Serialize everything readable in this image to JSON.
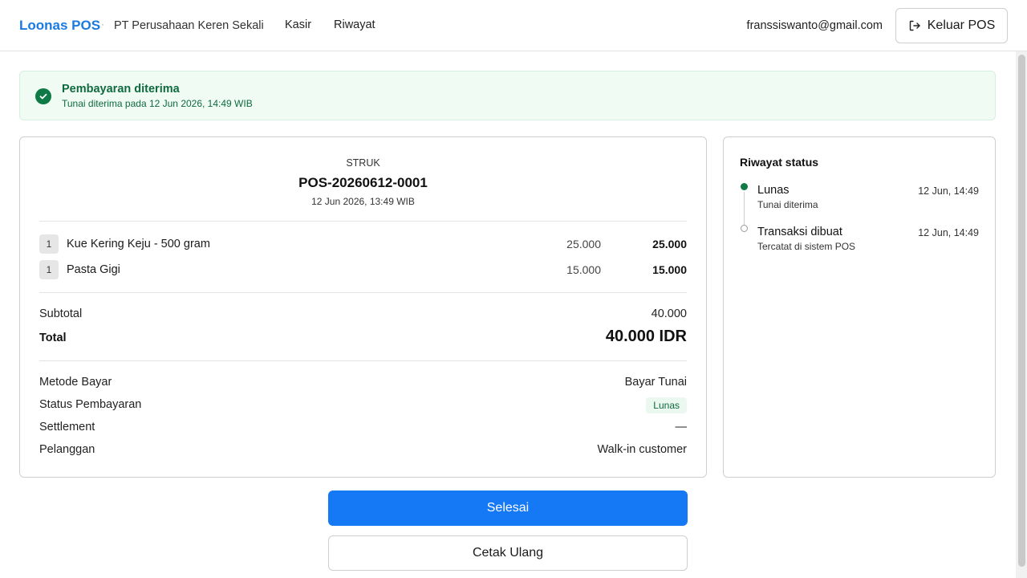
{
  "header": {
    "brand": "Loonas POS",
    "separator": "·",
    "company": "PT Perusahaan Keren Sekali",
    "nav": {
      "kasir": "Kasir",
      "riwayat": "Riwayat"
    },
    "email": "franssiswanto@gmail.com",
    "logout_label": "Keluar POS",
    "logout_icon": "logout-icon"
  },
  "alert": {
    "icon": "check-circle-icon",
    "title": "Pembayaran diterima",
    "subtitle": "Tunai diterima pada 12 Jun 2026, 14:49 WIB",
    "color": "#0f7a45"
  },
  "receipt": {
    "label": "STRUK",
    "number": "POS-20260612-0001",
    "datetime": "12 Jun 2026, 13:49 WIB",
    "items": [
      {
        "qty": "1",
        "name": "Kue Kering Keju - 500 gram",
        "unit_price": "25.000",
        "line_total": "25.000"
      },
      {
        "qty": "1",
        "name": "Pasta Gigi",
        "unit_price": "15.000",
        "line_total": "15.000"
      }
    ],
    "subtotal_label": "Subtotal",
    "subtotal_value": "40.000",
    "total_label": "Total",
    "total_value": "40.000 IDR",
    "details": {
      "method_label": "Metode Bayar",
      "method_value": "Bayar Tunai",
      "status_label": "Status Pembayaran",
      "status_value": "Lunas",
      "settlement_label": "Settlement",
      "settlement_value": "—",
      "customer_label": "Pelanggan",
      "customer_value": "Walk-in customer"
    }
  },
  "status_history": {
    "title": "Riwayat status",
    "entries": [
      {
        "title": "Lunas",
        "subtitle": "Tunai diterima",
        "time": "12 Jun, 14:49"
      },
      {
        "title": "Transaksi dibuat",
        "subtitle": "Tercatat di sistem POS",
        "time": "12 Jun, 14:49"
      }
    ]
  },
  "actions": {
    "primary_label": "Selesai",
    "secondary_label": "Cetak Ulang",
    "primary_color": "#1578f5"
  }
}
